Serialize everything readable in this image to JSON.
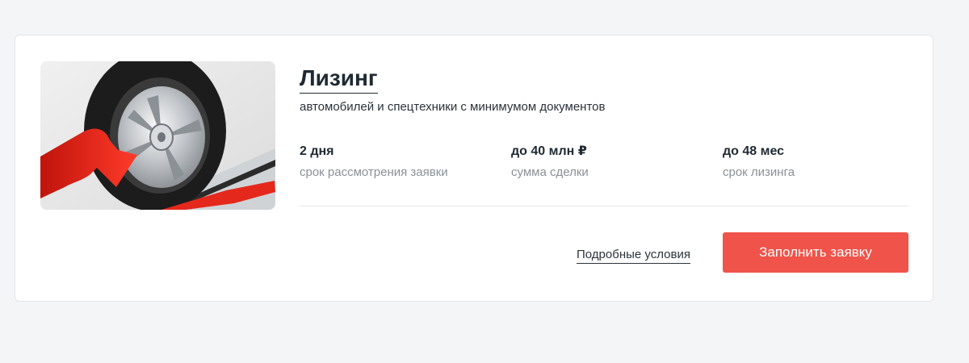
{
  "product": {
    "title": "Лизинг",
    "subtitle": "автомобилей и спецтехники с минимумом документов",
    "image": {
      "icon": "tire-with-red-arrow-illustration",
      "accent_color": "#e5281c"
    }
  },
  "stats": [
    {
      "value": "2 дня",
      "label": "срок рассмотрения заявки"
    },
    {
      "value": "до 40 млн ₽",
      "label": "сумма сделки"
    },
    {
      "value": "до 48 мес",
      "label": "срок лизинга"
    }
  ],
  "actions": {
    "details_label": "Подробные условия",
    "apply_label": "Заполнить заявку",
    "apply_color": "#ef5349"
  }
}
